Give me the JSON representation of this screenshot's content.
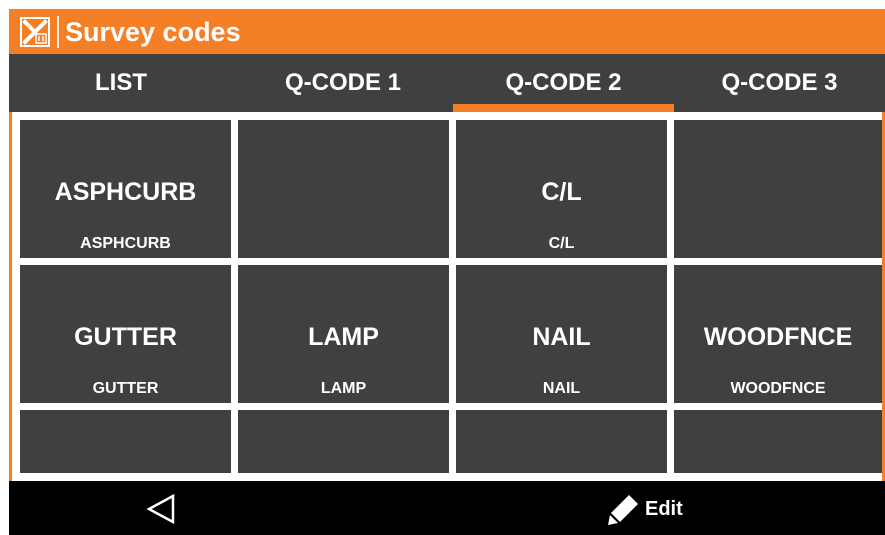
{
  "header": {
    "title": "Survey codes",
    "logo_icon": "app-logo-icon",
    "accent_color": "#F47F24",
    "bar_color": "#404040"
  },
  "tabs": [
    {
      "label": "LIST",
      "selected": false
    },
    {
      "label": "Q-CODE 1",
      "selected": false
    },
    {
      "label": "Q-CODE 2",
      "selected": true
    },
    {
      "label": "Q-CODE 3",
      "selected": false
    }
  ],
  "grid": {
    "rows": [
      [
        {
          "code": "ASPHCURB",
          "description": "ASPHCURB"
        },
        {
          "code": "",
          "description": ""
        },
        {
          "code": "C/L",
          "description": "C/L"
        },
        {
          "code": "",
          "description": ""
        }
      ],
      [
        {
          "code": "GUTTER",
          "description": "GUTTER"
        },
        {
          "code": "LAMP",
          "description": "LAMP"
        },
        {
          "code": "NAIL",
          "description": "NAIL"
        },
        {
          "code": "WOODFNCE",
          "description": "WOODFNCE"
        }
      ],
      [
        {
          "code": "",
          "description": ""
        },
        {
          "code": "",
          "description": ""
        },
        {
          "code": "",
          "description": ""
        },
        {
          "code": "",
          "description": ""
        }
      ]
    ]
  },
  "bottom": {
    "back_icon": "back-triangle-icon",
    "edit_icon": "pencil-icon",
    "edit_label": "Edit"
  }
}
